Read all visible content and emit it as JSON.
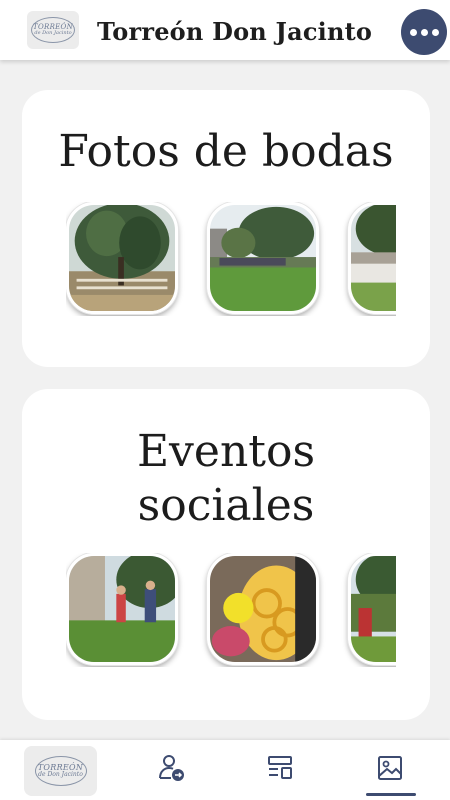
{
  "header": {
    "title": "Torreón Don Jacinto",
    "logo": {
      "line1": "TORREÓN",
      "line2": "de Don Jacinto"
    },
    "menu_icon": "more-dots-icon"
  },
  "sections": [
    {
      "title": "Fotos de bodas"
    },
    {
      "title": "Eventos sociales"
    }
  ],
  "bottom_nav": {
    "logo": {
      "line1": "TORREÓN",
      "line2": "de Don Jacinto"
    },
    "items": [
      {
        "icon": "user-arrow-icon"
      },
      {
        "icon": "layout-icon"
      },
      {
        "icon": "image-icon",
        "active": true
      }
    ]
  },
  "colors": {
    "accent": "#3d4b70",
    "background": "#f1f1f1",
    "card": "#ffffff"
  }
}
